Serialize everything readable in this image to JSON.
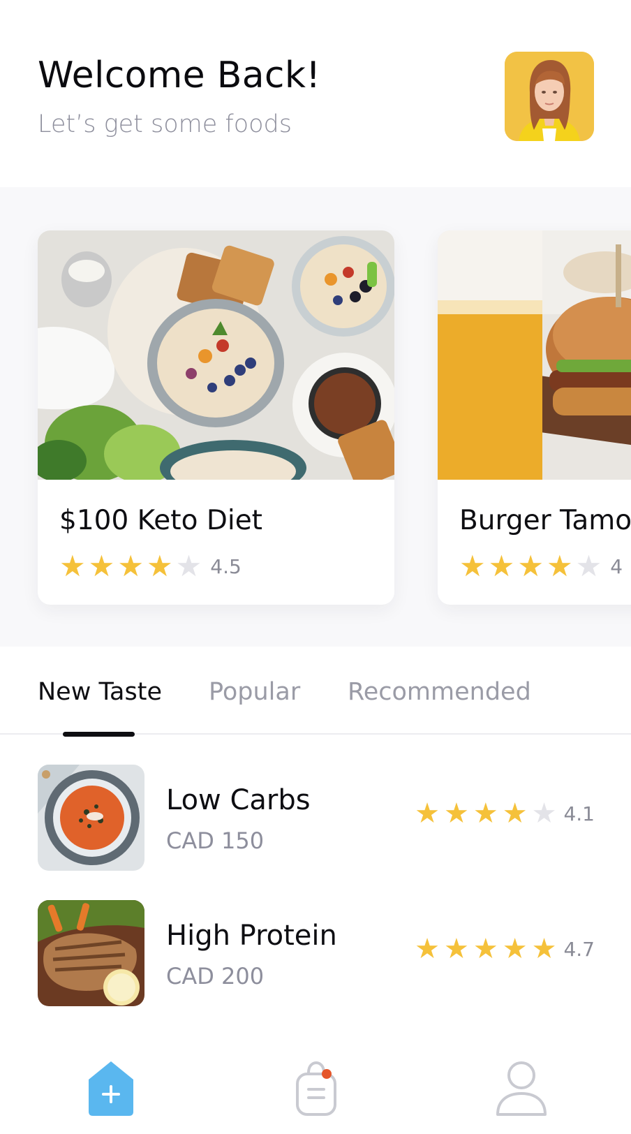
{
  "header": {
    "title": "Welcome Back!",
    "subtitle": "Let’s get some foods",
    "avatar_icon": "user-avatar"
  },
  "featured": [
    {
      "name": "$100 Keto Diet",
      "rating": "4.5",
      "stars": 4.5
    },
    {
      "name": "Burger Tamo",
      "rating": "4",
      "stars": 4.5
    }
  ],
  "tabs": [
    {
      "label": "New Taste",
      "active": true
    },
    {
      "label": "Popular",
      "active": false
    },
    {
      "label": "Recommended",
      "active": false
    }
  ],
  "items": [
    {
      "name": "Low Carbs",
      "price": "CAD 150",
      "rating": "4.1",
      "stars": 4
    },
    {
      "name": "High Protein",
      "price": "CAD 200",
      "rating": "4.7",
      "stars": 5
    }
  ],
  "nav": {
    "home_icon": "home-add-icon",
    "orders_icon": "shopping-bag-icon",
    "profile_icon": "profile-icon",
    "accent": "#5ab7ef",
    "badge_color": "#e5562a"
  },
  "colors": {
    "star": "#f5c13a",
    "star_off": "#e3e3e8",
    "muted_text": "#8d8e9c"
  }
}
